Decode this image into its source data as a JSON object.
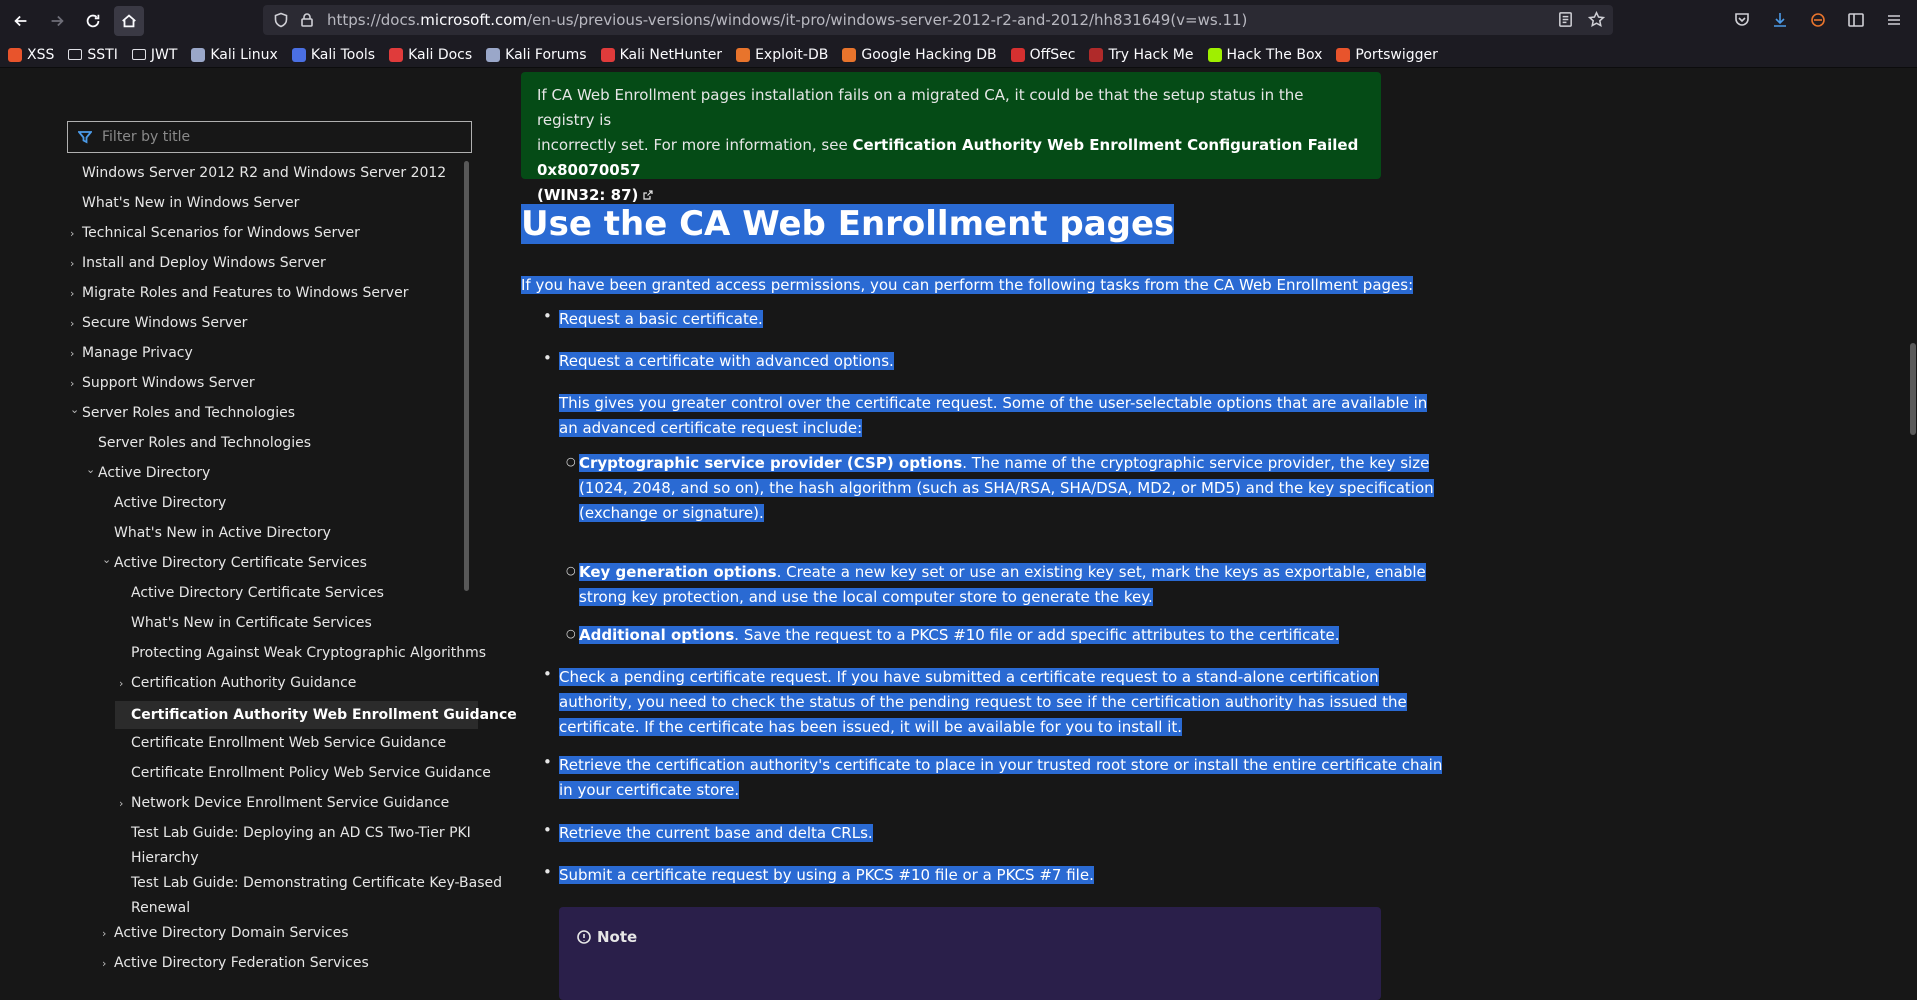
{
  "browser": {
    "url_prefix": "https://docs.",
    "url_domain": "microsoft.com",
    "url_path": "/en-us/previous-versions/windows/it-pro/windows-server-2012-r2-and-2012/hh831649(v=ws.11)",
    "bookmarks": [
      {
        "label": "XSS",
        "icon": "portswigger-icon",
        "color": "#e8542c"
      },
      {
        "label": "SSTI",
        "icon": "folder-icon",
        "color": "#e0e0e6"
      },
      {
        "label": "JWT",
        "icon": "folder-icon",
        "color": "#e0e0e6"
      },
      {
        "label": "Kali Linux",
        "icon": "kali-icon",
        "color": "#9aa7c9"
      },
      {
        "label": "Kali Tools",
        "icon": "kali-tools-icon",
        "color": "#4a6fe3"
      },
      {
        "label": "Kali Docs",
        "icon": "kali-docs-icon",
        "color": "#e03b3b"
      },
      {
        "label": "Kali Forums",
        "icon": "kali-icon",
        "color": "#9aa7c9"
      },
      {
        "label": "Kali NetHunter",
        "icon": "nethunter-icon",
        "color": "#e03b3b"
      },
      {
        "label": "Exploit-DB",
        "icon": "exploitdb-icon",
        "color": "#e8742c"
      },
      {
        "label": "Google Hacking DB",
        "icon": "ghdb-icon",
        "color": "#e8742c"
      },
      {
        "label": "OffSec",
        "icon": "offsec-icon",
        "color": "#d63030"
      },
      {
        "label": "Try Hack Me",
        "icon": "tryhackme-icon",
        "color": "#b02a2a"
      },
      {
        "label": "Hack The Box",
        "icon": "hackthebox-icon",
        "color": "#9fef00"
      },
      {
        "label": "Portswigger",
        "icon": "portswigger-icon",
        "color": "#e8542c"
      }
    ]
  },
  "sidebar": {
    "filter_placeholder": "Filter by title",
    "items": [
      {
        "label": "Windows Server 2012 R2 and Windows Server 2012",
        "level": 0,
        "chevron": ""
      },
      {
        "label": "What's New in Windows Server",
        "level": 0,
        "chevron": ""
      },
      {
        "label": "Technical Scenarios for Windows Server",
        "level": 0,
        "chevron": "›"
      },
      {
        "label": "Install and Deploy Windows Server",
        "level": 0,
        "chevron": "›"
      },
      {
        "label": "Migrate Roles and Features to Windows Server",
        "level": 0,
        "chevron": "›"
      },
      {
        "label": "Secure Windows Server",
        "level": 0,
        "chevron": "›"
      },
      {
        "label": "Manage Privacy",
        "level": 0,
        "chevron": "›"
      },
      {
        "label": "Support Windows Server",
        "level": 0,
        "chevron": "›"
      },
      {
        "label": "Server Roles and Technologies",
        "level": 0,
        "chevron": "⌄"
      },
      {
        "label": "Server Roles and Technologies",
        "level": 1,
        "chevron": ""
      },
      {
        "label": "Active Directory",
        "level": 1,
        "chevron": "⌄"
      },
      {
        "label": "Active Directory",
        "level": 2,
        "chevron": ""
      },
      {
        "label": "What's New in Active Directory",
        "level": 2,
        "chevron": ""
      },
      {
        "label": "Active Directory Certificate Services",
        "level": 2,
        "chevron": "⌄"
      },
      {
        "label": "Active Directory Certificate Services",
        "level": 3,
        "chevron": ""
      },
      {
        "label": "What's New in Certificate Services",
        "level": 3,
        "chevron": ""
      },
      {
        "label": "Protecting Against Weak Cryptographic Algorithms",
        "level": 3,
        "chevron": ""
      },
      {
        "label": "Certification Authority Guidance",
        "level": 3,
        "chevron": "›"
      },
      {
        "label": "Certification Authority Web Enrollment Guidance",
        "level": 3,
        "chevron": "",
        "active": true
      },
      {
        "label": "Certificate Enrollment Web Service Guidance",
        "level": 3,
        "chevron": ""
      },
      {
        "label": "Certificate Enrollment Policy Web Service Guidance",
        "level": 3,
        "chevron": ""
      },
      {
        "label": "Network Device Enrollment Service Guidance",
        "level": 3,
        "chevron": "›"
      },
      {
        "label": "Test Lab Guide: Deploying an AD CS Two-Tier PKI",
        "level": 3,
        "chevron": "",
        "cont": "Hierarchy"
      },
      {
        "label": "Test Lab Guide: Demonstrating Certificate Key-Based",
        "level": 3,
        "chevron": "",
        "cont": "Renewal"
      },
      {
        "label": "Active Directory Domain Services",
        "level": 2,
        "chevron": "›"
      },
      {
        "label": "Active Directory Federation Services",
        "level": 2,
        "chevron": "›"
      }
    ]
  },
  "content": {
    "alert_line1": "If CA Web Enrollment pages installation fails on a migrated CA, it could be that the setup status in the registry is",
    "alert_line2_a": "incorrectly set. For more information, see ",
    "alert_link_1": "Certification Authority Web Enrollment Configuration Failed 0x80070057",
    "alert_link_2": "(WIN32: 87)",
    "heading": "Use the CA Web Enrollment pages",
    "intro": "If you have been granted access permissions, you can perform the following tasks from the CA Web Enrollment pages:",
    "b1": "Request a basic certificate.",
    "b2": "Request a certificate with advanced options.",
    "b2_p1": "This gives you greater control over the certificate request. Some of the user-selectable options that are available in",
    "b2_p2": "an advanced certificate request include:",
    "s1_bold": "Cryptographic service provider (CSP) options",
    "s1_l1": ". The name of the cryptographic service provider, the key size",
    "s1_l2": "(1024, 2048, and so on), the hash algorithm (such as SHA/RSA, SHA/DSA, MD2, or MD5) and the key specification",
    "s1_l3": "(exchange or signature).",
    "s2_bold": "Key generation options",
    "s2_l1": ". Create a new key set or use an existing key set, mark the keys as exportable, enable",
    "s2_l2": "strong key protection, and use the local computer store to generate the key.",
    "s3_bold": "Additional options",
    "s3_l1": ". Save the request to a PKCS #10 file or add specific attributes to the certificate.",
    "b3_l1": "Check a pending certificate request. If you have submitted a certificate request to a stand-alone certification",
    "b3_l2": "authority, you need to check the status of the pending request to see if the certification authority has issued the",
    "b3_l3": "certificate. If the certificate has been issued, it will be available for you to install it.",
    "b4_l1": "Retrieve the certification authority's certificate to place in your trusted root store or install the entire certificate chain",
    "b4_l2": "in your certificate store.",
    "b5": "Retrieve the current base and delta CRLs.",
    "b6": "Submit a certificate request by using a PKCS #10 file or a PKCS #7 file.",
    "note_title": "Note"
  },
  "colors": {
    "selection": "#2a6ad3",
    "alert_bg": "#054b16",
    "note_bg": "#2a1f4a"
  }
}
